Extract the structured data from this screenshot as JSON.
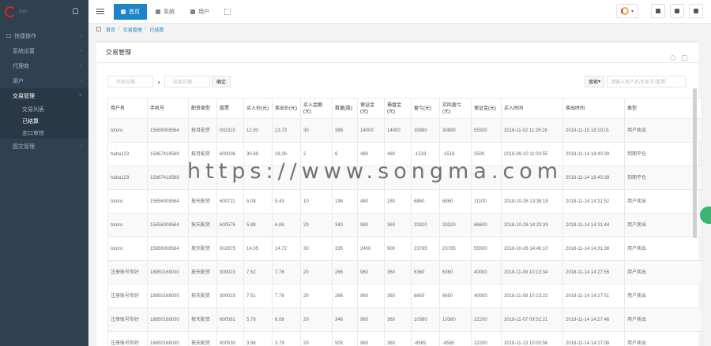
{
  "sidebar": {
    "logo_text": "logo",
    "items": [
      {
        "label": "快捷操作",
        "open": false
      },
      {
        "label": "系统设置",
        "open": false
      },
      {
        "label": "代理商",
        "open": false
      },
      {
        "label": "用户",
        "open": false
      },
      {
        "label": "交易管理",
        "open": true
      }
    ],
    "subitems": [
      {
        "label": "交易列表",
        "active": false
      },
      {
        "label": "已结算",
        "active": true
      },
      {
        "label": "走口审核",
        "active": false
      }
    ],
    "after": [
      {
        "label": "图文管理"
      }
    ]
  },
  "topbar": {
    "tabs": [
      {
        "label": "首页",
        "active": true
      },
      {
        "label": "系统",
        "active": false
      },
      {
        "label": "用户",
        "active": false
      }
    ]
  },
  "breadcrumb": [
    "首页",
    "交易管理",
    "已结算"
  ],
  "panel": {
    "title": "交易管理",
    "start_date_placeholder": "开始日期",
    "end_date_placeholder": "结束日期",
    "confirm_label": "确定",
    "search_select": "搜索",
    "search_placeholder": "请输入用户名/手机号/股票"
  },
  "table": {
    "columns": [
      "用户名",
      "手机号",
      "配资类型",
      "股票",
      "买入价(元)",
      "卖出价(元)",
      "买入金额(元)",
      "数量(股)",
      "保证金(元)",
      "操盘金(元)",
      "盈亏(元)",
      "实际盈亏(元)",
      "保证金(元)",
      "买入时间",
      "卖出时间",
      "类型"
    ],
    "rows": [
      [
        "totoro",
        "15656008564",
        "按月配资",
        "002315",
        "12.93",
        "13.73",
        "30",
        "386",
        "14000",
        "14000",
        "30880",
        "30880",
        "55500",
        "2018-11-02 11:26:28",
        "2018-11-15 18:19:01",
        "用户卖出"
      ],
      [
        "haha123",
        "15867418589",
        "按月配资",
        "600036",
        "30.69",
        "28.26",
        "2",
        "6",
        "480",
        "480",
        "-1518",
        "-1518",
        "2500",
        "2018-09-10 11:03:55",
        "2018-11-14 18:40:39",
        "到期平仓"
      ],
      [
        "haha123",
        "15867418589",
        "",
        "",
        "",
        "",
        "",
        "",
        "",
        "",
        "",
        "",
        "",
        "",
        "2018-11-14 18:40:39",
        "到期平仓"
      ],
      [
        "totoro",
        "15656008564",
        "按天配资",
        "600711",
        "5.08",
        "5.43",
        "10",
        "196",
        "480",
        "180",
        "6860",
        "6860",
        "11100",
        "2018-10-26 13:38:18",
        "2018-11-14 14:31:52",
        "用户卖出"
      ],
      [
        "totoro",
        "15656008564",
        "按天配资",
        "600576",
        "5.88",
        "6.86",
        "20",
        "340",
        "960",
        "360",
        "33320",
        "33320",
        "66600",
        "2018-10-26 14:23:39",
        "2018-11-14 14:31:44",
        "用户卖出"
      ],
      [
        "totoro",
        "15656008564",
        "按天配资",
        "002875",
        "14.05",
        "14.72",
        "30",
        "335",
        "2400",
        "900",
        "23785",
        "23785",
        "55500",
        "2018-10-26 14:45:10",
        "2018-11-14 14:31:38",
        "用户卖出"
      ],
      [
        "注册账号你好",
        "18850168030",
        "按天配资",
        "300023",
        "7.52",
        "7.76",
        "20",
        "265",
        "960",
        "360",
        "6360",
        "6360",
        "40000",
        "2018-11-09 10:13:34",
        "2018-11-14 14:27:55",
        "用户卖出"
      ],
      [
        "注册账号你好",
        "18850168030",
        "按天配资",
        "300023",
        "7.51",
        "7.76",
        "20",
        "266",
        "960",
        "360",
        "6650",
        "6650",
        "40000",
        "2018-11-09 10:13:22",
        "2018-11-14 14:27:51",
        "用户卖出"
      ],
      [
        "注册账号你好",
        "18850168030",
        "按天配资",
        "600561",
        "5.78",
        "6.08",
        "20",
        "346",
        "960",
        "360",
        "10380",
        "10380",
        "22200",
        "2018-11-07 09:52:21",
        "2018-11-14 14:27:46",
        "用户卖出"
      ],
      [
        "注册账号你好",
        "18850168030",
        "按天配资",
        "600530",
        "3.96",
        "3.79",
        "20",
        "505",
        "960",
        "360",
        "-8585",
        "-8585",
        "22200",
        "2018-11-13 10:00:56",
        "2018-11-14 14:27:08",
        "用户卖出"
      ]
    ]
  },
  "watermark": "https://www.songma.com"
}
